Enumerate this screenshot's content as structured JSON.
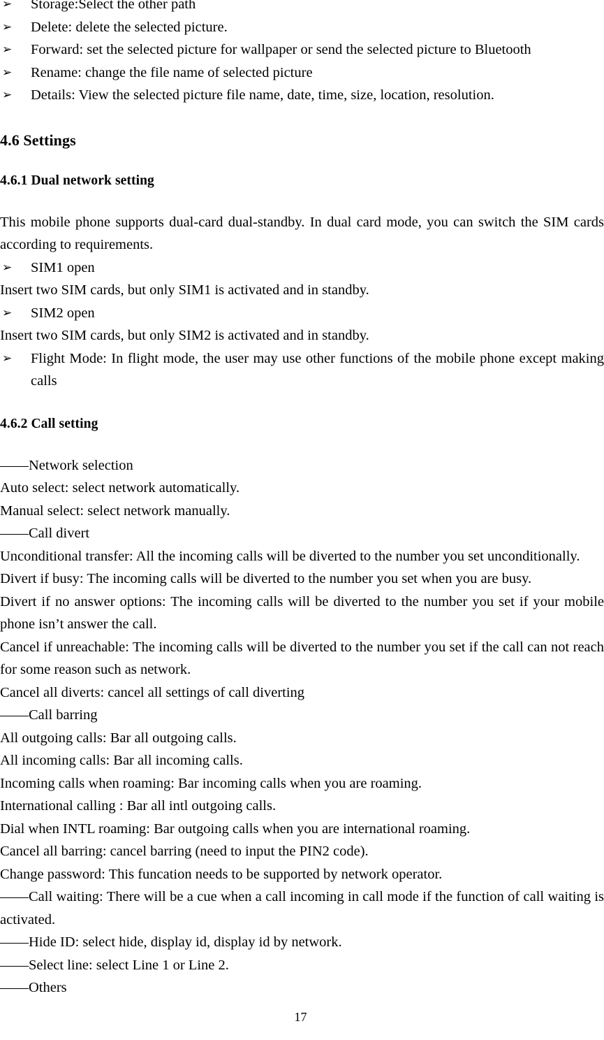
{
  "document": {
    "page_number": "17",
    "bullet_glyph": "➢"
  },
  "top_list": {
    "items": [
      "Storage:Select the other path",
      "Delete: delete the selected picture.",
      "Forward: set the selected picture for wallpaper or send the selected picture to Bluetooth",
      "Rename: change the file name of selected picture",
      "Details: View the selected picture file name, date, time, size, location, resolution."
    ]
  },
  "section_settings": {
    "heading": "4.6 Settings",
    "subsection_dual_network": {
      "heading": "4.6.1 Dual network setting",
      "intro": "This mobile phone supports dual-card dual-standby. In dual card mode, you can switch the SIM cards according to requirements.",
      "items": [
        {
          "bullet": "SIM1 open",
          "note": "Insert two SIM cards, but only SIM1 is activated and in standby."
        },
        {
          "bullet": "SIM2 open",
          "note": "Insert two SIM cards, but only SIM2 is activated and in standby."
        }
      ],
      "flight_mode": "Flight Mode: In flight mode, the user may use other functions of the mobile phone except making calls"
    },
    "subsection_call_setting": {
      "heading": "4.6.2 Call setting",
      "network_selection": {
        "label": "——Network selection",
        "lines": [
          "Auto select: select network automatically.",
          "Manual select: select network manually."
        ]
      },
      "call_divert": {
        "label": "——Call divert",
        "lines": [
          "Unconditional transfer: All the incoming calls will be diverted to the number you set unconditionally.",
          "Divert if busy: The incoming calls will be diverted to the number you set when you are busy.",
          "Divert if no answer options: The incoming calls will be diverted to the number you set if your mobile phone isn’t answer the call.",
          "Cancel if unreachable: The incoming calls will be diverted to the number you set if the call can not reach for some reason such as network.",
          "Cancel all diverts: cancel all settings of call diverting"
        ]
      },
      "call_barring": {
        "label": "——Call barring",
        "lines": [
          "All outgoing calls: Bar all outgoing calls.",
          "All incoming calls: Bar all incoming calls.",
          "Incoming calls when roaming: Bar incoming calls when you are roaming.",
          "International calling : Bar all intl outgoing calls.",
          "Dial when INTL roaming: Bar outgoing calls when you are international roaming.",
          "Cancel all barring: cancel barring (need to input the PIN2 code).",
          "Change password: This funcation needs to be supported by network operator."
        ]
      },
      "other_options": [
        "——Call waiting: There will be a cue when a call incoming in call mode if the function of call waiting is activated.",
        "——Hide ID: select hide, display id, display id by network.",
        "——Select line: select Line 1 or Line 2.",
        "——Others"
      ]
    }
  }
}
